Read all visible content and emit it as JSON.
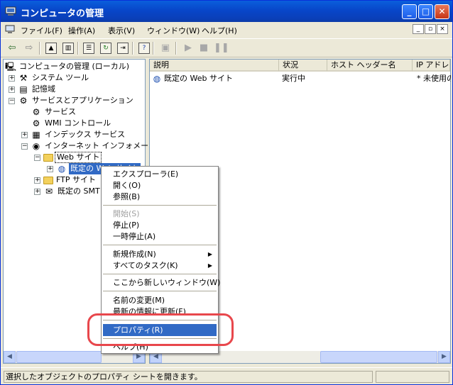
{
  "window": {
    "title": "コンピュータの管理",
    "buttons": [
      "_",
      "□",
      "✕"
    ]
  },
  "menubar": {
    "items": [
      "ファイル(F)",
      "操作(A)",
      "表示(V)",
      "ウィンドウ(W)",
      "ヘルプ(H)"
    ],
    "mdi_buttons": [
      "_",
      "▫",
      "×"
    ]
  },
  "toolbar": {
    "icons": [
      "back-arrow-icon",
      "forward-arrow-icon",
      "up-folder-icon",
      "show-hide-tree-icon",
      "properties-icon",
      "refresh-icon",
      "export-list-icon",
      "help-icon",
      "computer-icon",
      "start-icon",
      "stop-icon",
      "pause-icon"
    ]
  },
  "tree": {
    "root": "コンピュータの管理 (ローカル)",
    "items": [
      "システム ツール",
      "記憶域",
      "サービスとアプリケーション",
      "サービス",
      "WMI コントロール",
      "インデックス サービス",
      "インターネット インフォメーシ",
      "Web サイト",
      "既定の Web サイト",
      "FTP サイト",
      "既定の SMT"
    ]
  },
  "list": {
    "columns": [
      "説明",
      "状況",
      "ホスト ヘッダー名",
      "IP アドレス"
    ],
    "rows": [
      {
        "name": "既定の Web サイト",
        "status": "実行中",
        "host": "",
        "ip": "* 未使用の"
      }
    ]
  },
  "context_menu": {
    "items": [
      {
        "label": "エクスプローラ(E)"
      },
      {
        "label": "開く(O)"
      },
      {
        "label": "参照(B)"
      },
      {
        "label": "開始(S)",
        "disabled": true
      },
      {
        "label": "停止(P)"
      },
      {
        "label": "一時停止(A)"
      },
      {
        "label": "新規作成(N)",
        "submenu": true
      },
      {
        "label": "すべてのタスク(K)",
        "submenu": true
      },
      {
        "label": "ここから新しいウィンドウ(W)"
      },
      {
        "label": "名前の変更(M)"
      },
      {
        "label": "最新の情報に更新(F)"
      },
      {
        "label": "プロパティ(R)",
        "highlighted": true
      },
      {
        "label": "ヘルプ(H)"
      }
    ]
  },
  "statusbar": {
    "text": "選択したオブジェクトのプロパティ シートを開きます。"
  },
  "colors": {
    "titlebar": "#0a4fd0",
    "selection": "#316ac5",
    "annotation_ring": "#e8474c"
  }
}
